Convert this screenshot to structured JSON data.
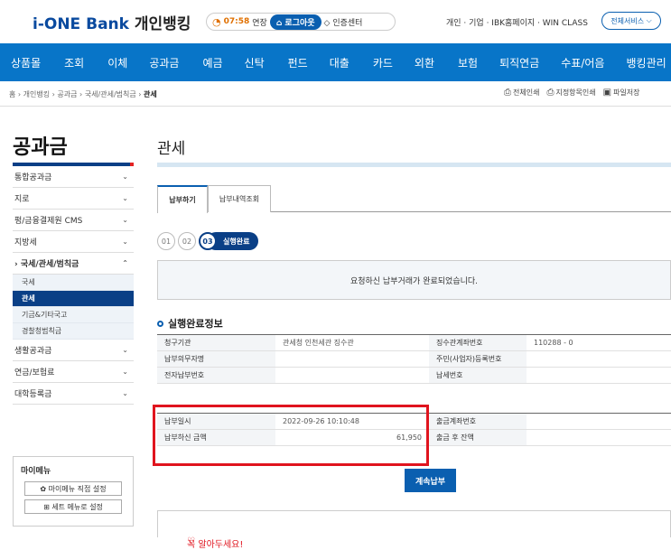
{
  "header": {
    "logo_brand": "i-ONE",
    "logo_bank": "Bank",
    "logo_service": "개인뱅킹",
    "timer_time": "07:58",
    "timer_extend": "연장",
    "logout_label": "로그아웃",
    "cert_center_label": "인증센터",
    "top_links": "개인 · 기업 · IBK홈페이지 · WIN CLASS",
    "all_services_label": "전체서비스"
  },
  "nav": {
    "items": [
      "상품몰",
      "조회",
      "이체",
      "공과금",
      "예금",
      "신탁",
      "펀드",
      "대출",
      "카드",
      "외환",
      "보험",
      "퇴직연금",
      "수표/어음",
      "뱅킹관리"
    ]
  },
  "breadcrumb": {
    "home": "홈",
    "l1": "개인뱅킹",
    "l2": "공과금",
    "l3": "국세/관세/범칙금",
    "current": "관세"
  },
  "tools": {
    "print_all": "전체인쇄",
    "print_selected": "지정항목인쇄",
    "save_file": "파일저장"
  },
  "sidebar": {
    "title": "공과금",
    "items": [
      {
        "label": "통합공과금"
      },
      {
        "label": "지로"
      },
      {
        "label": "펑/금융결제원 CMS"
      },
      {
        "label": "지방세"
      },
      {
        "label": "국세/관세/범칙금"
      }
    ],
    "subitems": [
      "국세",
      "관세",
      "기금&기타국고",
      "경찰청범칙금"
    ],
    "more_items": [
      {
        "label": "생활공과금"
      },
      {
        "label": "연금/보험료"
      },
      {
        "label": "대학등록금"
      }
    ],
    "mymenu_title": "마이메뉴",
    "mymenu_btn1": "마이메뉴 직접 설정",
    "mymenu_btn2": "세트 메뉴로 설정"
  },
  "main": {
    "title": "관세",
    "tab_pay": "납부하기",
    "tab_history": "납부내역조회",
    "step1": "01",
    "step2": "02",
    "step3": "03",
    "step3_label": "실행완료",
    "done_message": "요청하신 납부거래가 완료되었습니다.",
    "section_title": "실행완료정보",
    "rows1": [
      {
        "l1": "청구기관",
        "v1": "관세청 인천세관 징수관",
        "l2": "징수관계좌번호",
        "v2": "110288 - 0"
      },
      {
        "l1": "납부의무자명",
        "v1": "",
        "l2": "주민(사업자)등록번호",
        "v2": ""
      },
      {
        "l1": "전자납부번호",
        "v1": "",
        "l2": "납세번호",
        "v2": ""
      }
    ],
    "rows2": [
      {
        "l1": "납부일시",
        "v1": "2022-09-26 10:10:48",
        "l2": "출금계좌번호",
        "v2": ""
      },
      {
        "l1": "납부하신 금액",
        "v1": "61,950",
        "l2": "출금 후 잔액",
        "v2": ""
      }
    ],
    "continue_label": "계속납부",
    "notice_title": "꼭 알아두세요!"
  }
}
